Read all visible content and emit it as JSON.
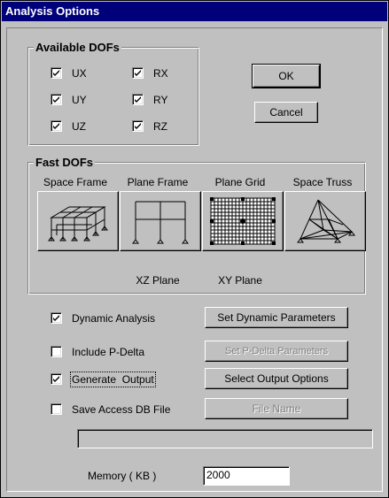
{
  "window": {
    "title": "Analysis Options"
  },
  "dofs": {
    "legend": "Available DOFs",
    "items": [
      {
        "label": "UX",
        "checked": true
      },
      {
        "label": "UY",
        "checked": true
      },
      {
        "label": "UZ",
        "checked": true
      },
      {
        "label": "RX",
        "checked": true
      },
      {
        "label": "RY",
        "checked": true
      },
      {
        "label": "RZ",
        "checked": true
      }
    ]
  },
  "buttons": {
    "ok": "OK",
    "cancel": "Cancel"
  },
  "fast": {
    "legend": "Fast DOFs",
    "types": [
      {
        "label": "Space Frame",
        "sub": ""
      },
      {
        "label": "Plane Frame",
        "sub": "XZ Plane"
      },
      {
        "label": "Plane Grid",
        "sub": "XY Plane"
      },
      {
        "label": "Space Truss",
        "sub": ""
      }
    ]
  },
  "options": [
    {
      "label": "Dynamic Analysis",
      "checked": true,
      "button": "Set Dynamic Parameters",
      "button_enabled": true
    },
    {
      "label": "Include P-Delta",
      "checked": false,
      "button": "Set P-Delta Parameters",
      "button_enabled": false
    },
    {
      "label": "Generate  Output",
      "checked": true,
      "button": "Select Output Options",
      "button_enabled": true
    },
    {
      "label": "Save Access DB File",
      "checked": false,
      "button": "File Name",
      "button_enabled": false
    }
  ],
  "filename_value": "",
  "memory": {
    "label": "Memory ( KB )",
    "value": "2000"
  },
  "colors": {
    "titlebar": "#00007b",
    "face": "#c0c0c0"
  }
}
